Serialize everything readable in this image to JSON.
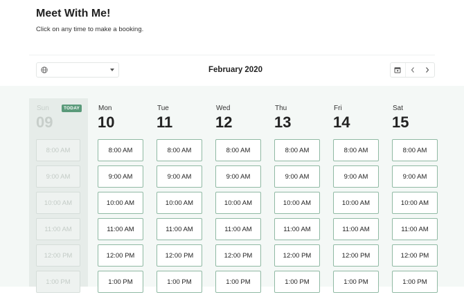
{
  "header": {
    "title": "Meet With Me!",
    "subtitle": "Click on any time to make a booking."
  },
  "toolbar": {
    "timezone_value": "",
    "month_label": "February 2020",
    "icons": {
      "timezone": "globe-icon",
      "calendar": "calendar-icon",
      "prev": "chevron-left-icon",
      "next": "chevron-right-icon"
    }
  },
  "days": [
    {
      "name": "Sun",
      "number": "09",
      "today": true,
      "badge": "TODAY",
      "slots": [
        "8:00 AM",
        "9:00 AM",
        "10:00 AM",
        "11:00 AM",
        "12:00 PM",
        "1:00 PM"
      ]
    },
    {
      "name": "Mon",
      "number": "10",
      "slots": [
        "8:00 AM",
        "9:00 AM",
        "10:00 AM",
        "11:00 AM",
        "12:00 PM",
        "1:00 PM"
      ]
    },
    {
      "name": "Tue",
      "number": "11",
      "slots": [
        "8:00 AM",
        "9:00 AM",
        "10:00 AM",
        "11:00 AM",
        "12:00 PM",
        "1:00 PM"
      ]
    },
    {
      "name": "Wed",
      "number": "12",
      "slots": [
        "8:00 AM",
        "9:00 AM",
        "10:00 AM",
        "11:00 AM",
        "12:00 PM",
        "1:00 PM"
      ]
    },
    {
      "name": "Thu",
      "number": "13",
      "slots": [
        "8:00 AM",
        "9:00 AM",
        "10:00 AM",
        "11:00 AM",
        "12:00 PM",
        "1:00 PM"
      ]
    },
    {
      "name": "Fri",
      "number": "14",
      "slots": [
        "8:00 AM",
        "9:00 AM",
        "10:00 AM",
        "11:00 AM",
        "12:00 PM",
        "1:00 PM"
      ]
    },
    {
      "name": "Sat",
      "number": "15",
      "slots": [
        "8:00 AM",
        "9:00 AM",
        "10:00 AM",
        "11:00 AM",
        "12:00 PM",
        "1:00 PM"
      ]
    }
  ],
  "colors": {
    "accent": "#5a9a7a",
    "slot_border": "#8fb9a3",
    "grid_background": "#f4f8f6",
    "past_column": "#e6ece9"
  }
}
